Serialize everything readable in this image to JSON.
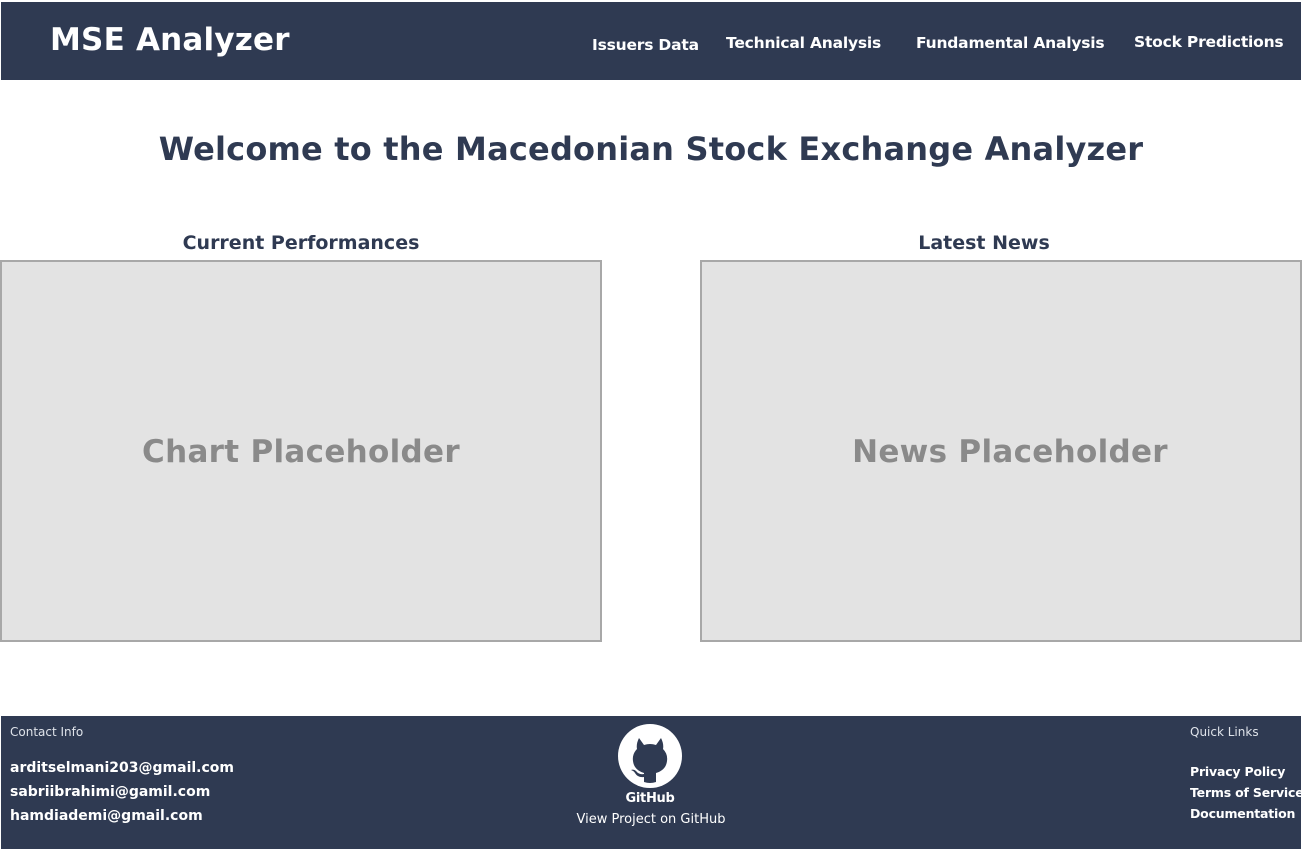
{
  "header": {
    "brand": "MSE Analyzer",
    "nav": [
      {
        "label": "Issuers Data"
      },
      {
        "label": "Technical Analysis"
      },
      {
        "label": "Fundamental Analysis"
      },
      {
        "label": "Stock Predictions"
      }
    ],
    "background_color": "#2f3a52"
  },
  "main": {
    "welcome_title": "Welcome to the Macedonian Stock Exchange Analyzer",
    "performance": {
      "title": "Current Performances",
      "placeholder": "Chart Placeholder"
    },
    "news": {
      "title": "Latest News",
      "placeholder": "News Placeholder"
    }
  },
  "footer": {
    "contact": {
      "heading": "Contact Info",
      "emails": [
        "arditselmani203@gmail.com",
        "sabriibrahimi@gamil.com",
        "hamdiademi@gmail.com"
      ]
    },
    "github": {
      "logo_text": "GitHub",
      "link_label": "View Project on GitHub",
      "icon": "github-octocat-icon"
    },
    "quick_links": {
      "heading": "Quick Links",
      "items": [
        {
          "label": "Privacy Policy"
        },
        {
          "label": "Terms of Service"
        },
        {
          "label": "Documentation"
        }
      ]
    }
  },
  "colors": {
    "primary": "#2f3a52",
    "placeholder_bg": "#e3e3e3",
    "placeholder_text": "#8a8a8a"
  }
}
